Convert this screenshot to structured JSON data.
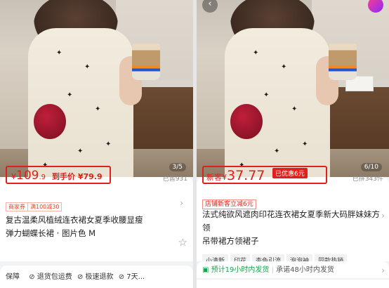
{
  "left": {
    "image_counter": "3/5",
    "currency": "¥",
    "price_int": "109",
    "price_dec": ".9",
    "to_hand_label": "到手价",
    "to_hand_price": "¥79.9",
    "sold": "已售931",
    "tag_1": "商家券",
    "tag_2": "满100减30",
    "title_line1": "复古温柔风植绒连衣裙女夏季收腰显瘦",
    "title_line2": "弹力蝴蝶长裙 · 图片色 M",
    "guarantee_label": "保障",
    "guarantee_1": "退货包运费",
    "guarantee_2": "极速退款",
    "guarantee_3": "7天..."
  },
  "right": {
    "image_counter": "6/10",
    "new_label": "新客",
    "currency": "¥",
    "price": "37.77",
    "discount_badge": "已优惠6元",
    "sold": "已拼343件",
    "coupon": "店铺新客立减6元",
    "title_line1": "法式纯欲风遮肉印花连衣裙女夏季新大码胖妹妹方领",
    "title_line2": "吊带裙方领裙子",
    "chips": [
      "小清新",
      "印花",
      "杏色引流",
      "泡泡袖",
      "同款热销"
    ],
    "ship_prefix": "预计19小时内发货",
    "ship_suffix": "承诺48小时内发货"
  },
  "colors": {
    "accent_red": "#e0201a",
    "green": "#16a34a"
  },
  "icons": [
    "back-arrow-icon",
    "favorite-app-icon",
    "chevron-right-icon",
    "star-icon",
    "truck-icon",
    "check-icon"
  ]
}
